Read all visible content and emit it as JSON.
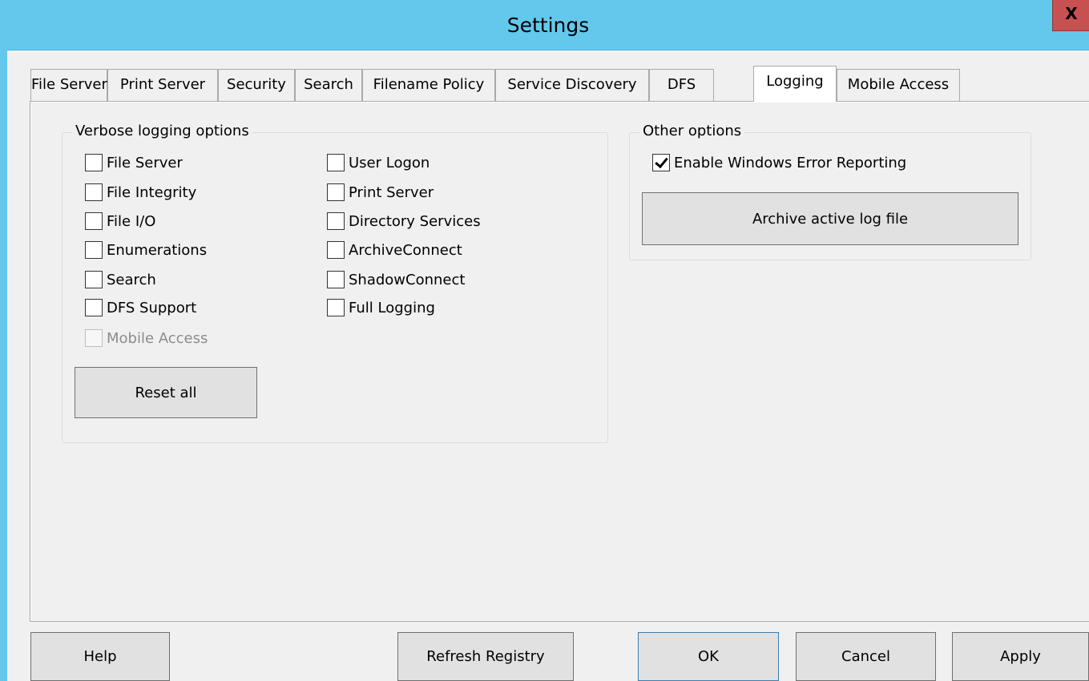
{
  "window": {
    "title": "Settings",
    "close_label": "X"
  },
  "tabs": [
    {
      "label": "File Server"
    },
    {
      "label": "Print Server"
    },
    {
      "label": "Security"
    },
    {
      "label": "Search"
    },
    {
      "label": "Filename Policy"
    },
    {
      "label": "Service Discovery"
    },
    {
      "label": "DFS"
    },
    {
      "label": "Logging",
      "active": true
    },
    {
      "label": "Mobile Access"
    }
  ],
  "verbose_group": {
    "title": "Verbose logging options",
    "left_options": [
      {
        "label": "File Server",
        "checked": false
      },
      {
        "label": "File Integrity",
        "checked": false
      },
      {
        "label": "File I/O",
        "checked": false
      },
      {
        "label": "Enumerations",
        "checked": false
      },
      {
        "label": "Search",
        "checked": false
      },
      {
        "label": "DFS Support",
        "checked": false
      },
      {
        "label": "Mobile Access",
        "checked": false,
        "disabled": true
      }
    ],
    "right_options": [
      {
        "label": "User Logon",
        "checked": false
      },
      {
        "label": "Print Server",
        "checked": false
      },
      {
        "label": "Directory Services",
        "checked": false
      },
      {
        "label": "ArchiveConnect",
        "checked": false
      },
      {
        "label": "ShadowConnect",
        "checked": false
      },
      {
        "label": "Full Logging",
        "checked": false
      }
    ],
    "reset_label": "Reset all"
  },
  "other_group": {
    "title": "Other options",
    "wer": {
      "label": "Enable Windows Error Reporting",
      "checked": true
    },
    "archive_label": "Archive active log file"
  },
  "footer": {
    "help_label": "Help",
    "refresh_label": "Refresh Registry",
    "ok_label": "OK",
    "cancel_label": "Cancel",
    "apply_label": "Apply"
  }
}
